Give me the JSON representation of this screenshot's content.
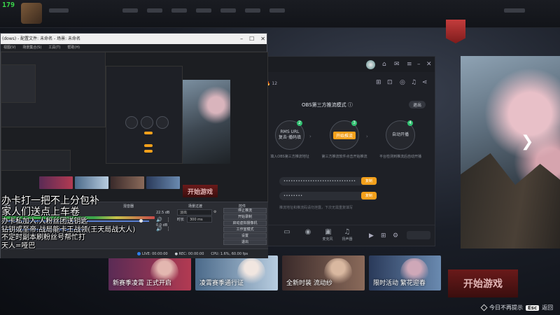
{
  "fps_counter": "179",
  "background": {
    "start_button": "开始游戏",
    "cards": [
      {
        "caption": "新赛季凌霄 正式开启",
        "c1": "#5a2b55",
        "c2": "#b23a52",
        "fig": "#e3b7b0"
      },
      {
        "caption": "凌霄赛季通行证",
        "c1": "#4b6a8a",
        "c2": "#b8cde0",
        "fig": "#f1e6e0"
      },
      {
        "caption": "全新时装 流动纱",
        "c1": "#3a2a2a",
        "c2": "#8a6a5a",
        "fig": "#d9b8a0"
      },
      {
        "caption": "限时活动 繁花迎春",
        "c1": "#2a3a5a",
        "c2": "#6a8ab0",
        "fig": "#cfa8b8"
      }
    ],
    "hint_text": "今日不再提示",
    "esc_key": "Esc",
    "return_text": "返回"
  },
  "streaming_app": {
    "viewer_count": "12",
    "mode_title": "OBS第三方推流模式",
    "exit_label": "退出",
    "steps": [
      {
        "num": "2",
        "label": "RMS URL",
        "sub": "复去·播码填",
        "desc": "填入OBS第三方推流地址"
      },
      {
        "num": "3",
        "label": "开始推流",
        "desc": "第三方推流软件点击开始推流"
      },
      {
        "num": "4",
        "label": "自动开播",
        "desc": "平台检测到推流后自动开播"
      }
    ],
    "url_masked": "••••••••••••••••••••••••••••••",
    "key_masked": "••••••••",
    "copy_label": "复制",
    "url_note": "推流地址和推流码请勿泄露，下次无需重复填写",
    "bottom_items": [
      "",
      "",
      "",
      "麦克风",
      "扬声器"
    ],
    "bottom_right": ""
  },
  "obs": {
    "title": "(dows) - 配置文件: 未命名 - 场景: 未命名",
    "menu": [
      "视图(V)",
      "场景集合(S)",
      "工具(T)",
      "帮助(H)"
    ],
    "docks": {
      "scenes": "场景",
      "sources": "",
      "mixer": "混音器",
      "transitions": "场景过渡",
      "controls": "控件"
    },
    "mixer_levels": [
      "22.5 dB",
      "0.0 dB"
    ],
    "transition": {
      "type": "淡出",
      "duration_label": "时长",
      "duration": "300 ms"
    },
    "controls": [
      "停止推流",
      "开始录制",
      "启动虚拟摄像机",
      "工作室模式",
      "设置",
      "退出"
    ],
    "status": {
      "live": "LIVE: 00:00:00",
      "rec": "REC: 00:00:00",
      "cpu": "CPU: 1.6%, 60.00 fps"
    },
    "preview_start": "开始游戏"
  },
  "overlay_text": [
    "办卡打一把不上分包补",
    "家人们送点上车卷",
    "办卡私加入:人粉丝团送钥匙",
    "钻钥或至帝:战局能卡王战领(王天局战大人)",
    "不定时副本刷粉丝号帮忙打",
    "天人=哑巴"
  ]
}
